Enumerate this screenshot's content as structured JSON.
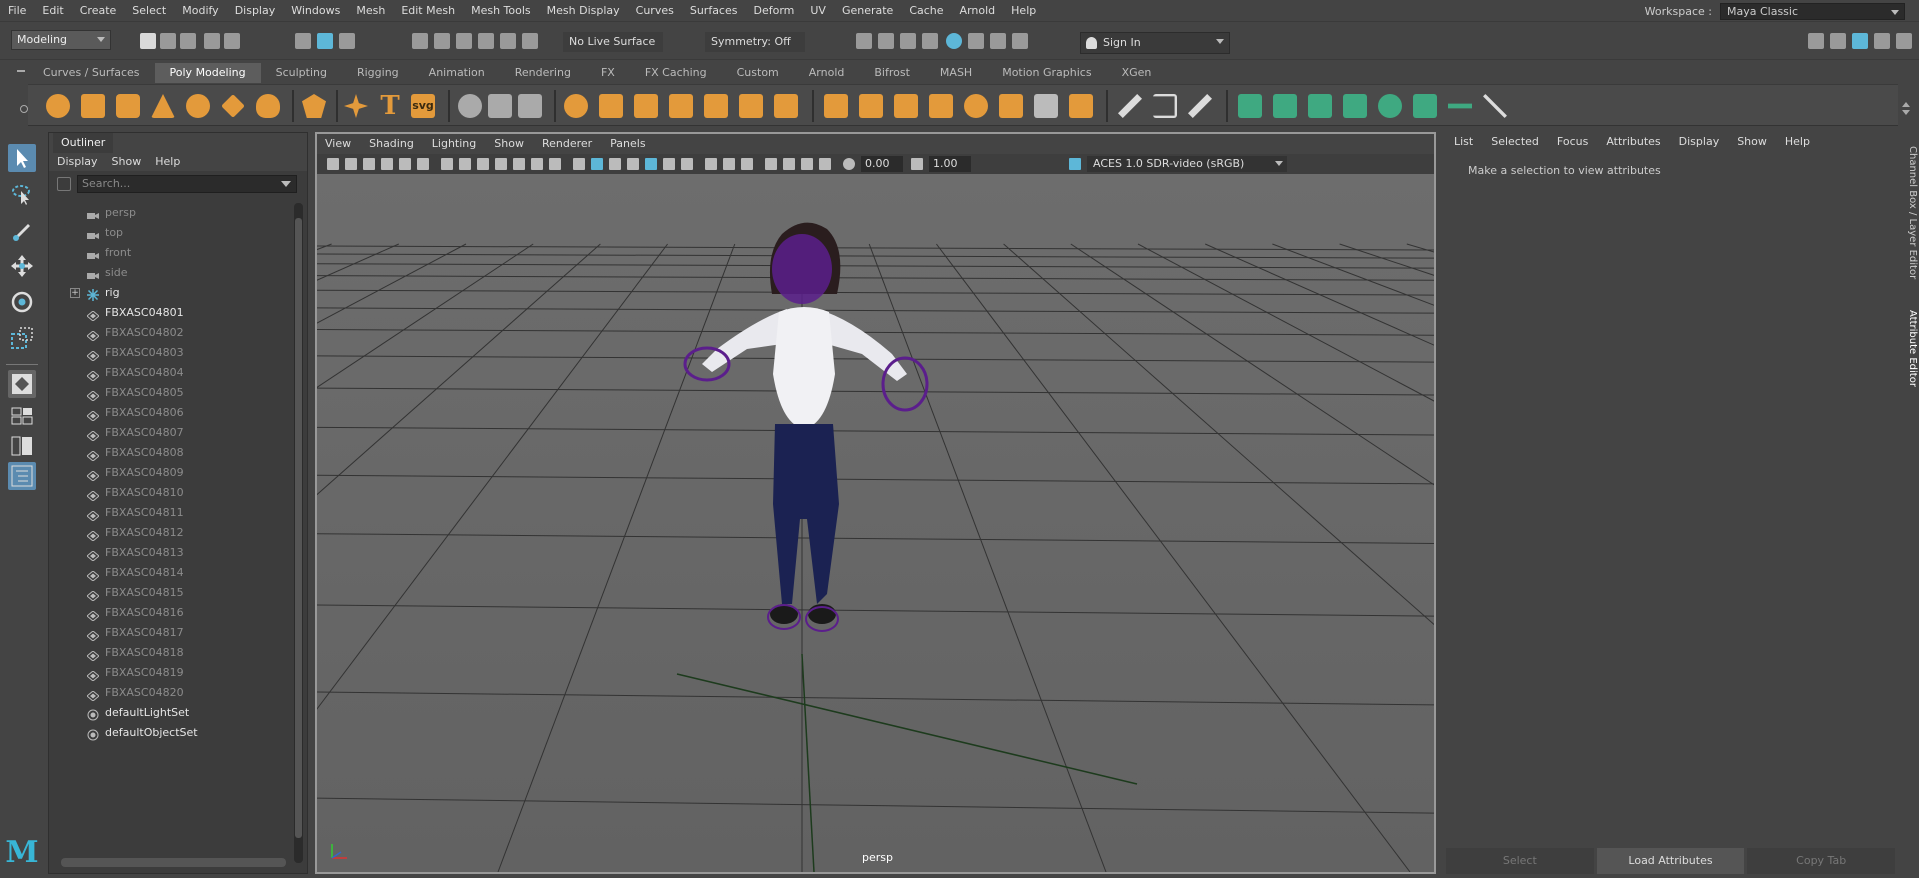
{
  "menubar": {
    "items": [
      "File",
      "Edit",
      "Create",
      "Select",
      "Modify",
      "Display",
      "Windows",
      "Mesh",
      "Edit Mesh",
      "Mesh Tools",
      "Mesh Display",
      "Curves",
      "Surfaces",
      "Deform",
      "UV",
      "Generate",
      "Cache",
      "Arnold",
      "Help"
    ],
    "workspace_label": "Workspace :",
    "workspace_value": "Maya Classic"
  },
  "statusline": {
    "mode": "Modeling",
    "live_surface": "No Live Surface",
    "symmetry": "Symmetry: Off",
    "sign_in": "Sign In"
  },
  "shelf": {
    "tabs": [
      "Curves / Surfaces",
      "Poly Modeling",
      "Sculpting",
      "Rigging",
      "Animation",
      "Rendering",
      "FX",
      "FX Caching",
      "Custom",
      "Arnold",
      "Bifrost",
      "MASH",
      "Motion Graphics",
      "XGen"
    ],
    "active_tab": "Poly Modeling",
    "svg_label": "svg",
    "text_label": "T"
  },
  "outliner": {
    "title": "Outliner",
    "menu": [
      "Display",
      "Show",
      "Help"
    ],
    "search_placeholder": "Search...",
    "items": [
      {
        "label": "persp",
        "icon": "camera-icon",
        "dim": true
      },
      {
        "label": "top",
        "icon": "camera-icon",
        "dim": true
      },
      {
        "label": "front",
        "icon": "camera-icon",
        "dim": true
      },
      {
        "label": "side",
        "icon": "camera-icon",
        "dim": true
      },
      {
        "label": "rig",
        "icon": "joint-icon",
        "dim": false,
        "expandable": true
      },
      {
        "label": "FBXASC04801",
        "icon": "mesh-icon",
        "dim": false
      },
      {
        "label": "FBXASC04802",
        "icon": "mesh-icon",
        "dim": true
      },
      {
        "label": "FBXASC04803",
        "icon": "mesh-icon",
        "dim": true
      },
      {
        "label": "FBXASC04804",
        "icon": "mesh-icon",
        "dim": true
      },
      {
        "label": "FBXASC04805",
        "icon": "mesh-icon",
        "dim": true
      },
      {
        "label": "FBXASC04806",
        "icon": "mesh-icon",
        "dim": true
      },
      {
        "label": "FBXASC04807",
        "icon": "mesh-icon",
        "dim": true
      },
      {
        "label": "FBXASC04808",
        "icon": "mesh-icon",
        "dim": true
      },
      {
        "label": "FBXASC04809",
        "icon": "mesh-icon",
        "dim": true
      },
      {
        "label": "FBXASC04810",
        "icon": "mesh-icon",
        "dim": true
      },
      {
        "label": "FBXASC04811",
        "icon": "mesh-icon",
        "dim": true
      },
      {
        "label": "FBXASC04812",
        "icon": "mesh-icon",
        "dim": true
      },
      {
        "label": "FBXASC04813",
        "icon": "mesh-icon",
        "dim": true
      },
      {
        "label": "FBXASC04814",
        "icon": "mesh-icon",
        "dim": true
      },
      {
        "label": "FBXASC04815",
        "icon": "mesh-icon",
        "dim": true
      },
      {
        "label": "FBXASC04816",
        "icon": "mesh-icon",
        "dim": true
      },
      {
        "label": "FBXASC04817",
        "icon": "mesh-icon",
        "dim": true
      },
      {
        "label": "FBXASC04818",
        "icon": "mesh-icon",
        "dim": true
      },
      {
        "label": "FBXASC04819",
        "icon": "mesh-icon",
        "dim": true
      },
      {
        "label": "FBXASC04820",
        "icon": "mesh-icon",
        "dim": true
      },
      {
        "label": "defaultLightSet",
        "icon": "set-icon",
        "dim": false
      },
      {
        "label": "defaultObjectSet",
        "icon": "set-icon",
        "dim": false
      }
    ]
  },
  "viewport": {
    "menu": [
      "View",
      "Shading",
      "Lighting",
      "Show",
      "Renderer",
      "Panels"
    ],
    "exposure": "0.00",
    "gamma": "1.00",
    "colorspace": "ACES 1.0 SDR-video (sRGB)",
    "camera": "persp"
  },
  "attribute_editor": {
    "menu": [
      "List",
      "Selected",
      "Focus",
      "Attributes",
      "Display",
      "Show",
      "Help"
    ],
    "message": "Make a selection to view attributes",
    "buttons": [
      "Select",
      "Load Attributes",
      "Copy Tab"
    ]
  },
  "side_tabs": [
    "Channel Box / Layer Editor",
    "Attribute Editor"
  ],
  "logo_letter": "M",
  "colors": {
    "accent": "#5db7d8",
    "shelf_orange": "#e39a3b",
    "shelf_teal": "#3fa981",
    "wire_purple": "#5b1e8c"
  }
}
